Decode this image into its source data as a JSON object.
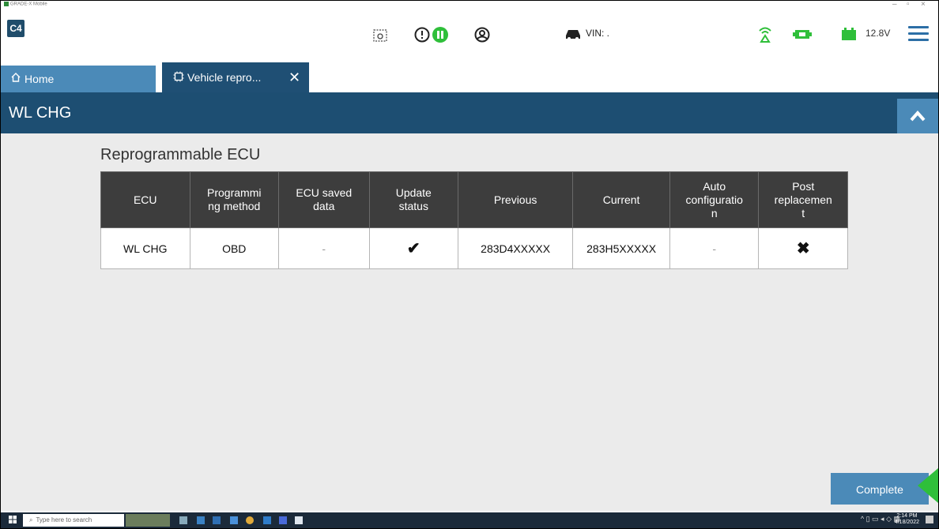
{
  "window": {
    "app_title": "GRADE-X Mobile",
    "minimize": "–",
    "restore": "▫",
    "close": "×"
  },
  "toolbar": {
    "logo": "C4",
    "vin_label": "VIN: .",
    "voltage": "12.8V"
  },
  "tabs": [
    {
      "label": "Home",
      "icon": "home-icon",
      "active": false
    },
    {
      "label": "Vehicle repro...",
      "icon": "chip-icon",
      "active": true,
      "close": "✕"
    }
  ],
  "header": {
    "title": "WL CHG",
    "collapse_icon": "chevron-up-icon"
  },
  "section": {
    "title": "Reprogrammable ECU"
  },
  "table": {
    "columns": [
      "ECU",
      "Programmi\nng method",
      "ECU saved\ndata",
      "Update\nstatus",
      "Previous",
      "Current",
      "Auto\nconfiguratio\nn",
      "Post\nreplacemen\nt"
    ],
    "rows": [
      {
        "ecu": "WL CHG",
        "method": "OBD",
        "saved_data": "-",
        "update_status": "✔",
        "previous": "283D4XXXXX",
        "current": "283H5XXXXX",
        "auto_config": "-",
        "post_replacement": "✖"
      }
    ]
  },
  "actions": {
    "complete_label": "Complete"
  },
  "taskbar": {
    "search_placeholder": "Type here to search",
    "time": "2:14 PM",
    "date": "4/18/2022"
  },
  "colors": {
    "header_bg": "#1d4e72",
    "accent": "#4b8ab8",
    "status_green": "#2fbf3a",
    "table_header": "#3d3d3d"
  }
}
